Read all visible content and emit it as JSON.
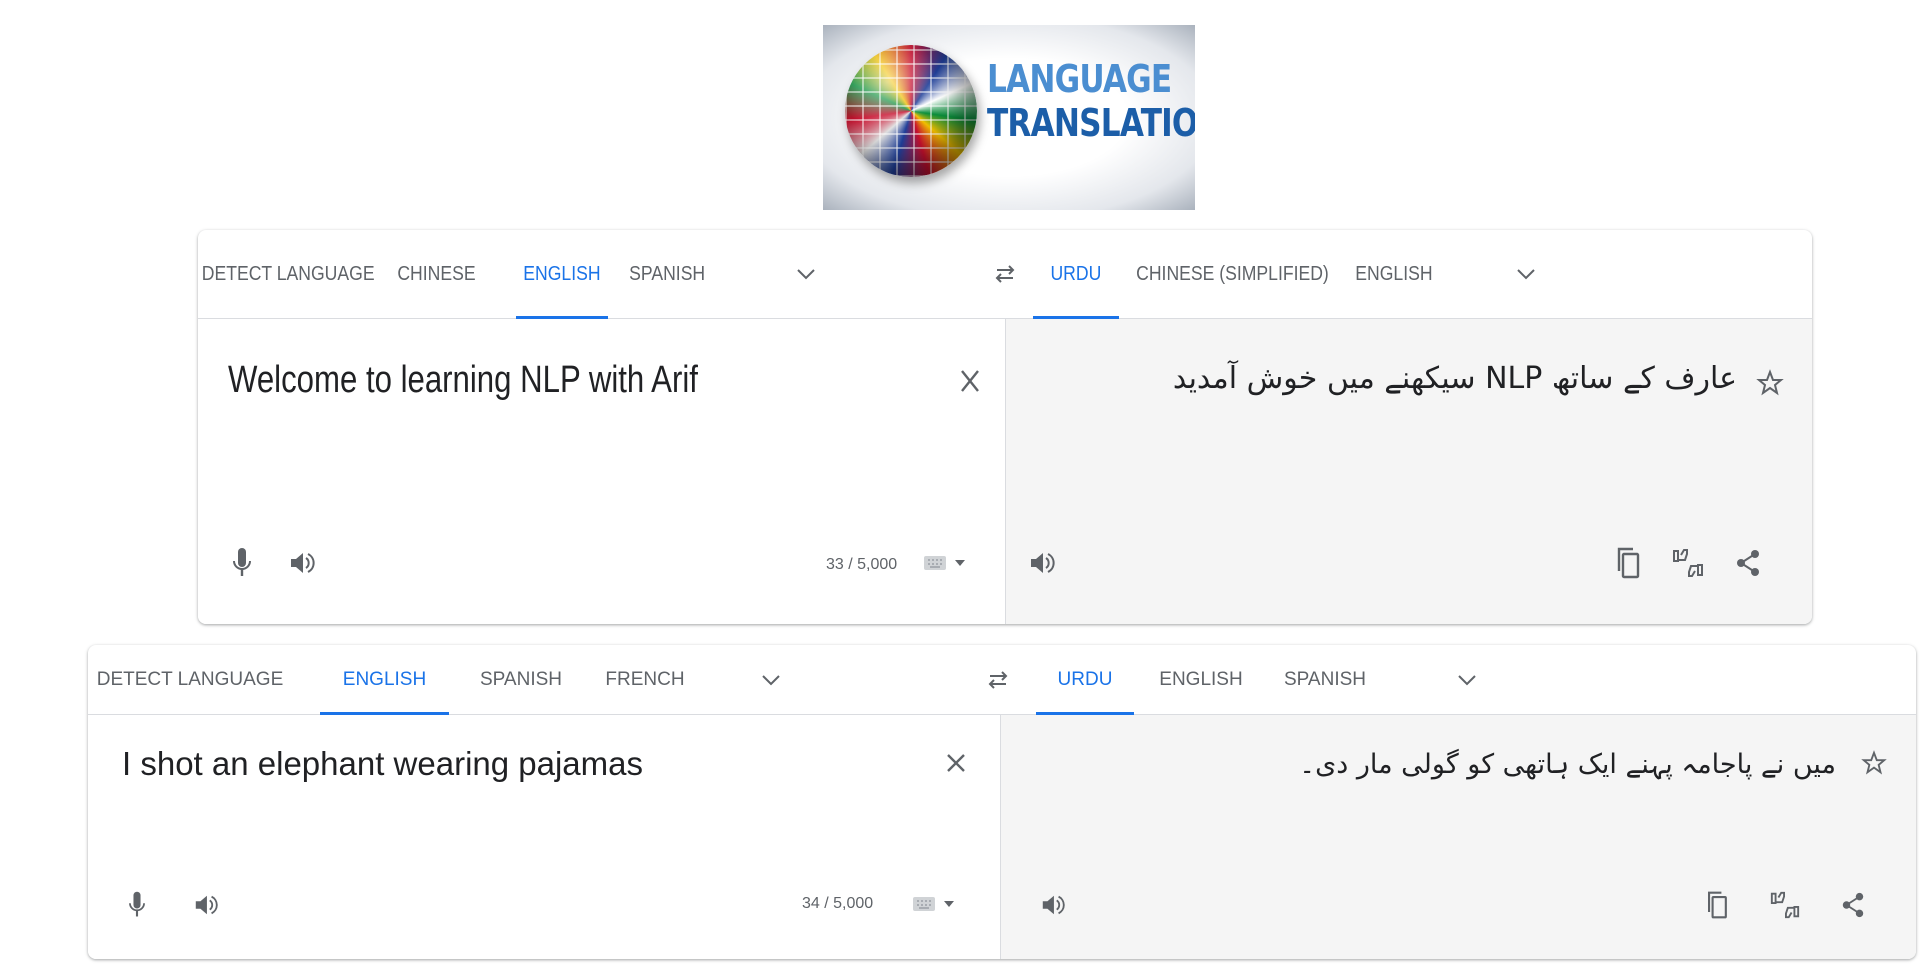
{
  "logo": {
    "line1": "LANGUAGE",
    "line2": "TRANSLATION",
    "image": "globe-of-flags"
  },
  "colors": {
    "accent": "#1a73e8",
    "icon": "#5f6368",
    "text": "#202124",
    "target_bg": "#f5f5f5"
  },
  "panel1": {
    "source_tabs": [
      "DETECT LANGUAGE",
      "CHINESE",
      "ENGLISH",
      "SPANISH"
    ],
    "source_active": "ENGLISH",
    "target_tabs": [
      "URDU",
      "CHINESE (SIMPLIFIED)",
      "ENGLISH"
    ],
    "target_active": "URDU",
    "source_text": "Welcome to learning NLP with Arif",
    "target_text": "عارف کے ساتھ NLP سیکھنے میں خوش آمدید",
    "char_count": "33 / 5,000",
    "icons": [
      "chevron-down",
      "swap-arrows",
      "clear-x",
      "microphone",
      "speaker",
      "keyboard",
      "star",
      "copy",
      "feedback-thumbs",
      "share"
    ]
  },
  "panel2": {
    "source_tabs": [
      "DETECT LANGUAGE",
      "ENGLISH",
      "SPANISH",
      "FRENCH"
    ],
    "source_active": "ENGLISH",
    "target_tabs": [
      "URDU",
      "ENGLISH",
      "SPANISH"
    ],
    "target_active": "URDU",
    "source_text": "I shot an elephant wearing pajamas",
    "target_text": "میں نے پاجامہ پہنے ایک ہاتھی کو گولی مار دی۔",
    "char_count": "34 / 5,000",
    "icons": [
      "chevron-down",
      "swap-arrows",
      "clear-x",
      "microphone",
      "speaker",
      "keyboard",
      "star",
      "copy",
      "feedback-thumbs",
      "share"
    ]
  }
}
